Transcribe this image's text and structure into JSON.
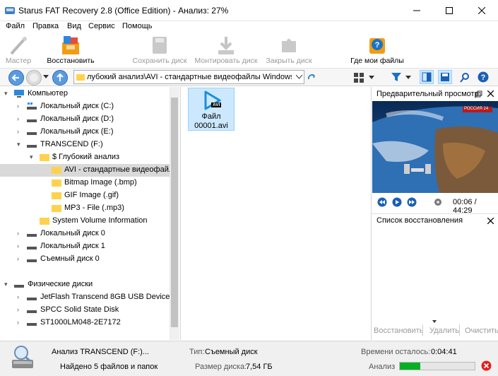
{
  "window": {
    "title": "Starus FAT Recovery 2.8 (Office Edition) - Анализ: 27%"
  },
  "menu": [
    "Файл",
    "Правка",
    "Вид",
    "Сервис",
    "Помощь"
  ],
  "toolbar": {
    "wizard": "Мастер",
    "restore": "Восстановить",
    "save_disk": "Сохранить диск",
    "mount_disk": "Монтировать диск",
    "close_disk": "Закрыть диск",
    "where_files": "Где мои файлы"
  },
  "path": "лубокий анализ\\AVI - стандартные видеофайлы Windows (.avi)",
  "tree": [
    {
      "label": "Компьютер"
    },
    {
      "label": "Локальный диск (C:)"
    },
    {
      "label": "Локальный диск (D:)"
    },
    {
      "label": "Локальный диск (E:)"
    },
    {
      "label": "TRANSCEND (F:)"
    },
    {
      "label": "$ Глубокий анализ"
    },
    {
      "label": "AVI - стандартные видеофайл"
    },
    {
      "label": "Bitmap Image (.bmp)"
    },
    {
      "label": "GIF Image (.gif)"
    },
    {
      "label": "MP3 - File (.mp3)"
    },
    {
      "label": "System Volume Information"
    },
    {
      "label": "Локальный диск 0"
    },
    {
      "label": "Локальный диск 1"
    },
    {
      "label": "Съемный диск 0"
    },
    {
      "label": "Физические диски"
    },
    {
      "label": "JetFlash Transcend 8GB USB Device"
    },
    {
      "label": "SPCC Solid State Disk"
    },
    {
      "label": "ST1000LM048-2E7172"
    }
  ],
  "file": {
    "badge": "AVI",
    "name_line1": "Файл",
    "name_line2": "00001.avi"
  },
  "preview": {
    "title": "Предварительный просмотр",
    "time": "00:06 / 44:29",
    "channel_tag": "РОССИЯ 24"
  },
  "recovery": {
    "title": "Список восстановления",
    "restore": "Восстановить",
    "delete": "Удалить",
    "clear": "Очистить"
  },
  "status": {
    "analysis": "Анализ TRANSCEND (F:)...",
    "found": "Найдено 5 файлов и папок",
    "type_label": "Тип:",
    "type_value": "Съемный диск",
    "size_label": "Размер диска:",
    "size_value": "7,54 ГБ",
    "time_left_label": "Времени осталось:",
    "time_left_value": "0:04:41",
    "progress_label": "Анализ",
    "progress_fraction": 0.27
  },
  "colors": {
    "accent": "#0078d7",
    "progress": "#06b025",
    "selection": "#cce8ff",
    "tree_selection": "#d9d9d9"
  }
}
